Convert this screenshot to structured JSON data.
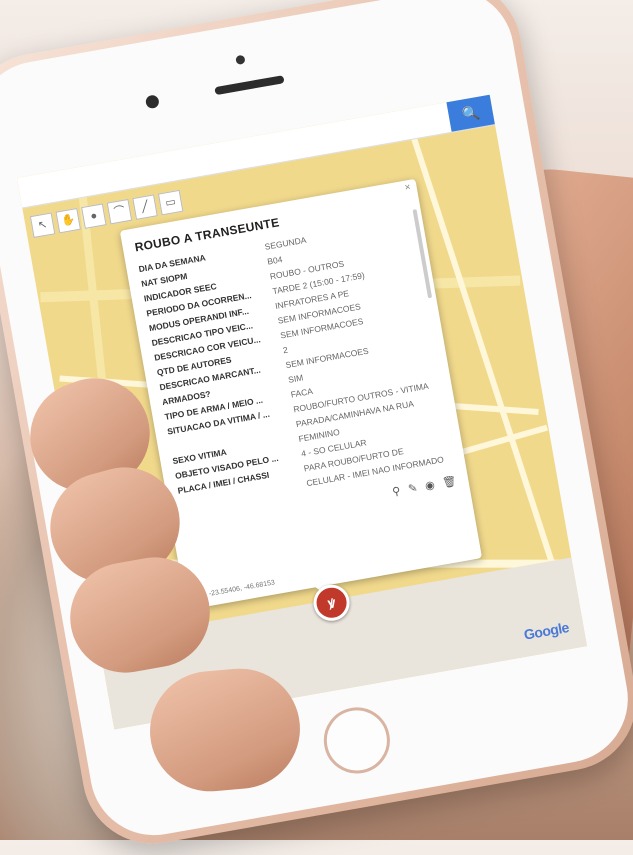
{
  "popup": {
    "title": "ROUBO A TRANSEUNTE",
    "close": "×",
    "rows": [
      {
        "label": "DIA DA SEMANA",
        "value": "SEGUNDA"
      },
      {
        "label": "NAT SIOPM",
        "value": "B04"
      },
      {
        "label": "INDICADOR SEEC",
        "value": "ROUBO - OUTROS"
      },
      {
        "label": "PERIODO DA OCORREN...",
        "value": "TARDE 2 (15:00 - 17:59)"
      },
      {
        "label": "MODUS OPERANDI INF...",
        "value": "INFRATORES A PE"
      },
      {
        "label": "DESCRICAO TIPO VEIC...",
        "value": "SEM INFORMACOES"
      },
      {
        "label": "DESCRICAO COR VEICU...",
        "value": "SEM INFORMACOES"
      },
      {
        "label": "QTD DE AUTORES",
        "value": "2"
      },
      {
        "label": "DESCRICAO MARCANT...",
        "value": "SEM INFORMACOES"
      },
      {
        "label": "ARMADOS?",
        "value": "SIM"
      },
      {
        "label": "TIPO DE ARMA / MEIO ...",
        "value": "FACA"
      },
      {
        "label": "SITUACAO DA VITIMA / ...",
        "value": "ROUBO/FURTO OUTROS - VITIMA PARADA/CAMINHAVA NA RUA"
      },
      {
        "label": "SEXO VITIMA",
        "value": "FEMININO"
      },
      {
        "label": "OBJETO VISADO PELO ...",
        "value": "4 - SO CELULAR"
      },
      {
        "label": "PLACA / IMEI / CHASSI",
        "value": "PARA ROUBO/FURTO DE CELULAR - IMEI NAO INFORMADO"
      }
    ],
    "coords": "-23.55406, -46.68153"
  },
  "search": {
    "placeholder": "",
    "button": "🔍"
  },
  "toolbar": [
    "↖",
    "✋",
    "●",
    "⌒",
    "╱",
    "▭"
  ],
  "map": {
    "brand": "Google",
    "pin_icon": "marker-robbery-icon"
  },
  "colors": {
    "map": "#f1d98c",
    "search_button": "#3b7ddd",
    "pin": "#c0392b"
  }
}
